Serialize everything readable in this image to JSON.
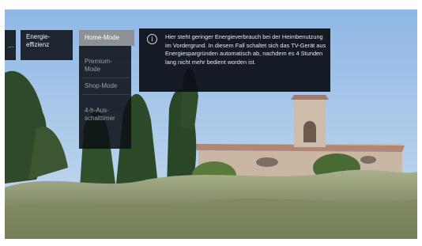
{
  "menu": {
    "previous_indicator": "...",
    "parent_item": "Energie-\neffizienz",
    "options": [
      {
        "label": "Home-Mode",
        "selected": true
      },
      {
        "label": "Premium-\nMode",
        "selected": false
      },
      {
        "label": "Shop-Mode",
        "selected": false
      },
      {
        "label": "4-h-Aus-\nschalttimer",
        "selected": false
      }
    ]
  },
  "info": {
    "icon": "info-circle-icon",
    "icon_glyph": "i",
    "text": "Hier steht geringer Energieverbrauch bei der Heimbenutzung im Vordergrund. In diesem Fall schaltet sich das TV-Gerät aus Energiespargründen automatisch ab, nachdem es 4 Stunden lang nicht mehr bedient worden ist."
  }
}
